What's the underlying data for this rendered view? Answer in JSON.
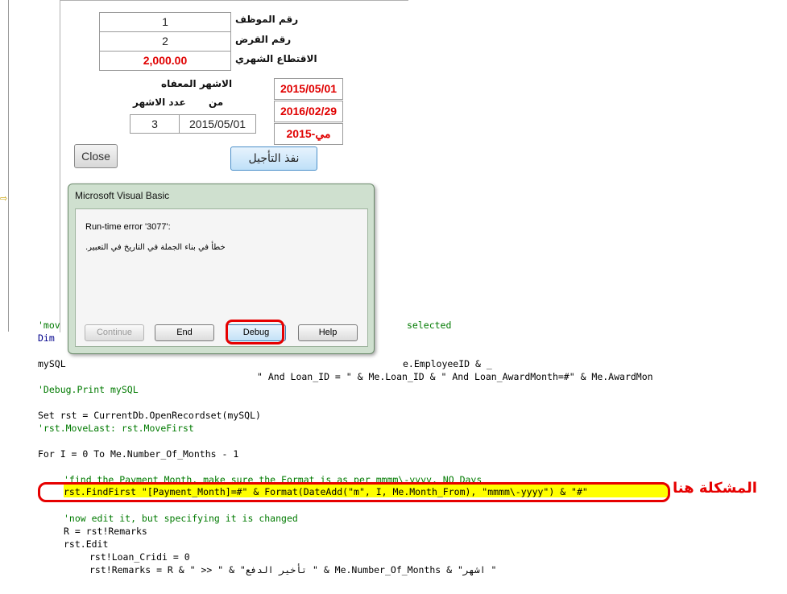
{
  "form": {
    "employee_id_label": "رقم الموظف",
    "employee_id_value": "1",
    "loan_id_label": "رقم القرض",
    "loan_id_value": "2",
    "monthly_deduction_label": "الاقتطاع الشهري",
    "monthly_deduction_value": "2,000.00",
    "exempt_months_label": "الاشهر المعفاه",
    "from_label": "من",
    "months_count_label": "عدد الاشهر",
    "from_value": "2015/05/01",
    "months_count_value": "3",
    "date1": "2015/05/01",
    "date2": "2016/02/29",
    "date3": "مي-2015",
    "close_label": "Close",
    "execute_label": "نفذ التأجيل"
  },
  "dialog": {
    "title": "Microsoft Visual Basic",
    "error_code": "Run-time error '3077':",
    "error_message": "خطأ في بناء الجملة في التاريخ في التعبير.",
    "buttons": {
      "continue": "Continue",
      "end": "End",
      "debug": "Debug",
      "help": "Help"
    }
  },
  "code": {
    "line1_visible_start": "'mov",
    "line1_visible_end": "selected",
    "line2_visible": "Dim",
    "line3_start": "mySQL",
    "line3_end": "e.EmployeeID & _",
    "line4": "\" And Loan_ID = \" & Me.Loan_ID & \" And Loan_AwardMonth=#\" & Me.AwardMon",
    "line5": "'Debug.Print mySQL",
    "line6": "Set rst = CurrentDb.OpenRecordset(mySQL)",
    "line7": "'rst.MoveLast: rst.MoveFirst",
    "line8": "For I = 0 To Me.Number_Of_Months - 1",
    "line9": "'find the Payment Month, make sure the Format is as per mmmm\\-yyyy, NO Days",
    "line10": "rst.FindFirst \"[Payment_Month]=#\" & Format(DateAdd(\"m\", I, Me.Month_From), \"mmmm\\-yyyy\") & \"#\"",
    "line11": "'now edit it, but specifying it is changed",
    "line12": "R = rst!Remarks",
    "line13": "rst.Edit",
    "line14": "rst!Loan_Cridi = 0",
    "line15": "rst!Remarks = R & \" >> \" & \"تأخير الدفع \" & Me.Number_Of_Months & \"اشهر \"",
    "problem_label": "المشكلة هنا"
  },
  "colors": {
    "error_red": "#e00000",
    "highlight_yellow": "#ffff00",
    "comment_green": "#007a00"
  }
}
